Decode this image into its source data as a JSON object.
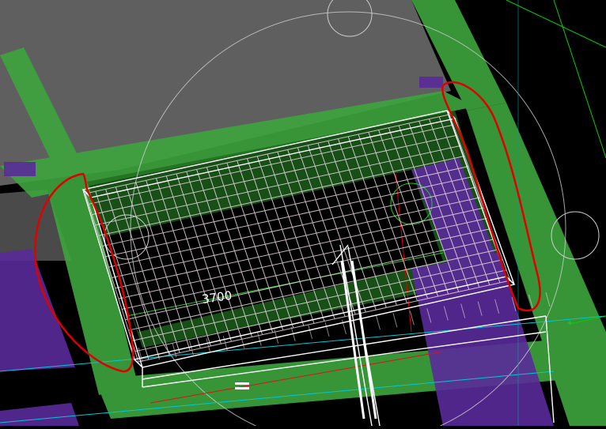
{
  "viewport": {
    "background": "#000000",
    "dimension_label": "3700",
    "colors": {
      "slab_gray": "#5f5f5f",
      "beam_green": "#3faa3f",
      "column_purple": "#5a2a9a",
      "rebar_white": "#ffffff",
      "rebar_pink": "#d8c8d0",
      "annotation_red": "#e00000",
      "axis_cyan": "#00c8d8",
      "axis_green": "#00d000",
      "circle_gray": "#cfcfcf"
    }
  },
  "icons": {
    "grid_marker": "circle",
    "annotation": "red-freehand-ellipse"
  }
}
